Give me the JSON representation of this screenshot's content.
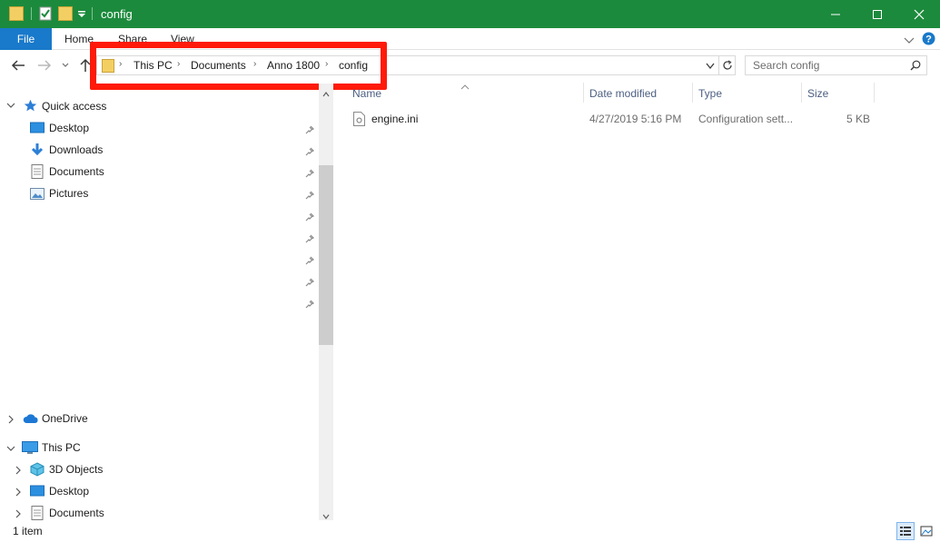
{
  "window": {
    "title": "config",
    "accent_color": "#1c8a3c",
    "controls": [
      "minimize-icon",
      "maximize-icon",
      "close-icon"
    ]
  },
  "ribbon": {
    "tabs": [
      "File",
      "Home",
      "Share",
      "View"
    ]
  },
  "address": {
    "breadcrumb": [
      "This PC",
      "Documents",
      "Anno 1800",
      "config"
    ],
    "highlight_color": "#ff1a0a"
  },
  "search": {
    "placeholder": "Search config"
  },
  "nav": {
    "quick_access": {
      "label": "Quick access",
      "items": [
        "Desktop",
        "Downloads",
        "Documents",
        "Pictures"
      ]
    },
    "onedrive": {
      "label": "OneDrive"
    },
    "this_pc": {
      "label": "This PC",
      "children": [
        "3D Objects",
        "Desktop",
        "Documents"
      ]
    }
  },
  "columns": [
    "Name",
    "Date modified",
    "Type",
    "Size"
  ],
  "files": [
    {
      "name": "engine.ini",
      "date_modified": "4/27/2019 5:16 PM",
      "type": "Configuration sett...",
      "size": "5 KB"
    }
  ],
  "status": {
    "item_count": "1 item"
  }
}
